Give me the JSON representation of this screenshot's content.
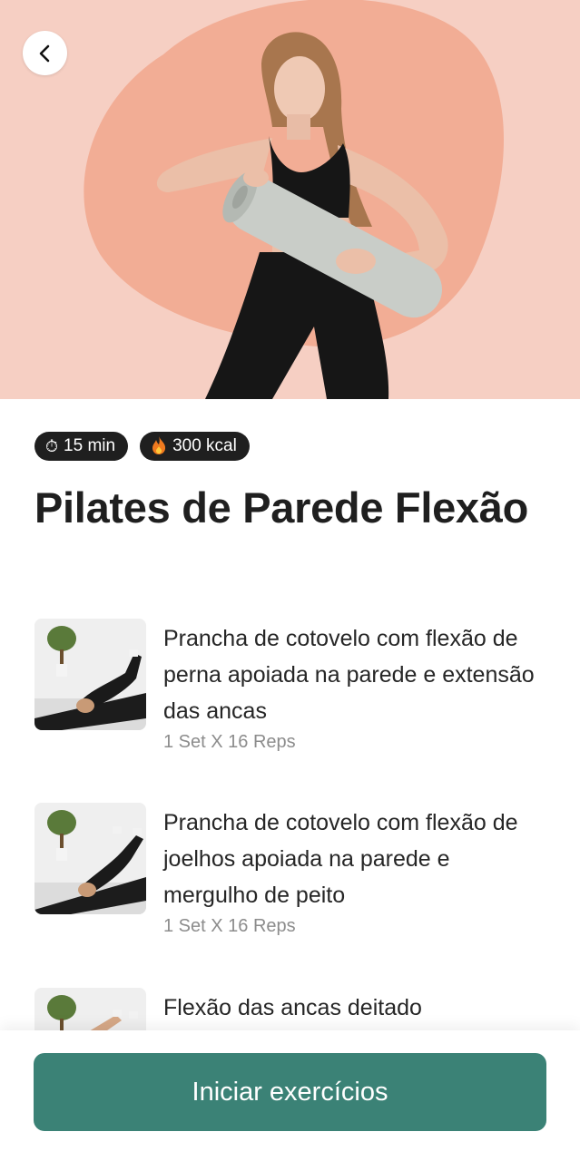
{
  "header": {
    "back_icon": "chevron-left-icon",
    "hero_image": "woman-holding-yoga-mat"
  },
  "stats": {
    "duration_icon": "stopwatch-icon",
    "duration": "15 min",
    "calories_icon": "fire-icon",
    "calories": "300 kcal"
  },
  "workout": {
    "title": "Pilates de Parede Flexão"
  },
  "exercises": [
    {
      "name": "Prancha de cotovelo com flexão de perna apoiada na parede e extensão das ancas",
      "reps": "1 Set X 16 Reps",
      "thumbnail": "exercise-thumbnail"
    },
    {
      "name": "Prancha de cotovelo com flexão de joelhos apoiada na parede e mergulho de peito",
      "reps": "1 Set X 16 Reps",
      "thumbnail": "exercise-thumbnail"
    },
    {
      "name": "Flexão das ancas deitado",
      "reps": "",
      "thumbnail": "exercise-thumbnail"
    }
  ],
  "footer": {
    "start_label": "Iniciar exercícios"
  },
  "colors": {
    "hero_bg": "#f6cfc3",
    "hero_blob": "#f2ad95",
    "badge_bg": "#1f1f1f",
    "primary": "#3b8276"
  }
}
